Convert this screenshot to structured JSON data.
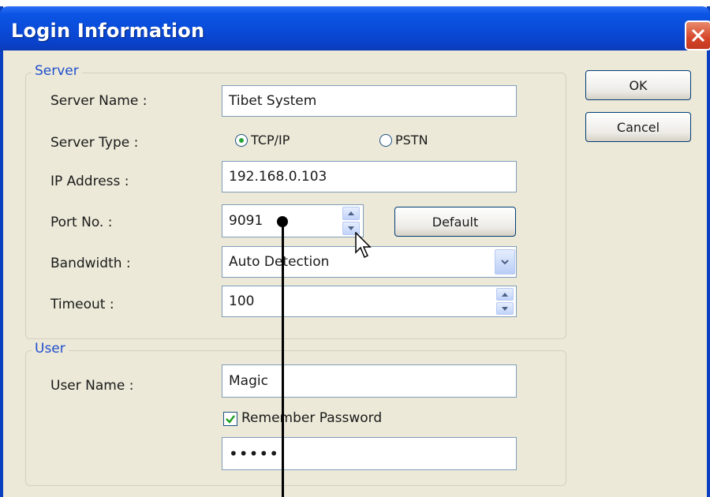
{
  "window": {
    "title": "Login Information"
  },
  "server": {
    "group_label": "Server",
    "server_name": {
      "label": "Server Name :",
      "value": "Tibet System"
    },
    "server_type": {
      "label": "Server Type :",
      "options": [
        "TCP/IP",
        "PSTN"
      ],
      "selected": "TCP/IP"
    },
    "ip_address": {
      "label": "IP Address :",
      "value": "192.168.0.103"
    },
    "port": {
      "label": "Port No. :",
      "value": "9091",
      "default_button": "Default"
    },
    "bandwidth": {
      "label": "Bandwidth :",
      "value": "Auto Detection"
    },
    "timeout": {
      "label": "Timeout :",
      "value": "100"
    }
  },
  "user": {
    "group_label": "User",
    "user_name": {
      "label": "User Name :",
      "value": "Magic"
    },
    "remember_password": {
      "label": "Remember Password",
      "checked": true
    },
    "password": {
      "value": "•••••"
    }
  },
  "buttons": {
    "ok": "OK",
    "cancel": "Cancel"
  },
  "colors": {
    "title_bar": "#0a4bd8",
    "group_label": "#1f4fce",
    "close": "#d6452a",
    "radio_dot": "#2aa33a"
  }
}
